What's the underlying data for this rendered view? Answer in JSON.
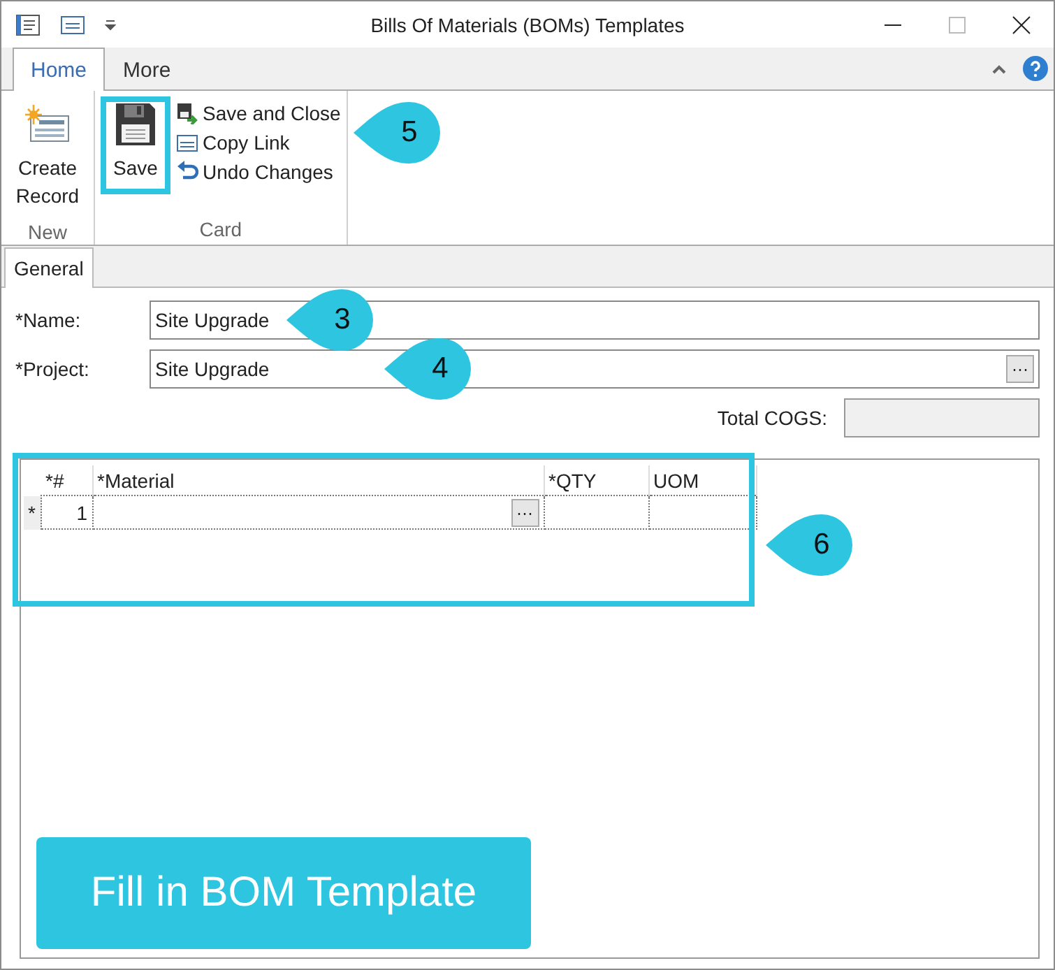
{
  "window": {
    "title": "Bills Of Materials (BOMs) Templates"
  },
  "ribbon_tabs": [
    {
      "label": "Home",
      "selected": true
    },
    {
      "label": "More",
      "selected": false
    }
  ],
  "ribbon_groups": [
    {
      "label": "New",
      "large": [
        {
          "label": "Create Record",
          "highlighted": false
        }
      ]
    },
    {
      "label": "Card",
      "large": [
        {
          "label": "Save",
          "highlighted": true,
          "callout": "5"
        }
      ],
      "small": [
        {
          "label": "Save and Close"
        },
        {
          "label": "Copy Link"
        },
        {
          "label": "Undo Changes"
        }
      ]
    }
  ],
  "form_tabs": [
    {
      "label": "General",
      "selected": true
    }
  ],
  "fields": [
    {
      "kind": "text",
      "label": "*Name:",
      "value": "Site Upgrade",
      "callout": "3"
    },
    {
      "kind": "lookup",
      "label": "*Project:",
      "value": "Site Upgrade",
      "button": "···",
      "callout": "4"
    }
  ],
  "total_cogs": {
    "label": "Total COGS:"
  },
  "grid": {
    "columns": [
      "*#",
      "*Material",
      "*QTY",
      "UOM"
    ],
    "highlighted": true,
    "callout": "6",
    "rows": [
      {
        "marker": "*",
        "number": "1",
        "button": "···"
      }
    ]
  },
  "banner": {
    "text": "Fill in BOM Template"
  }
}
